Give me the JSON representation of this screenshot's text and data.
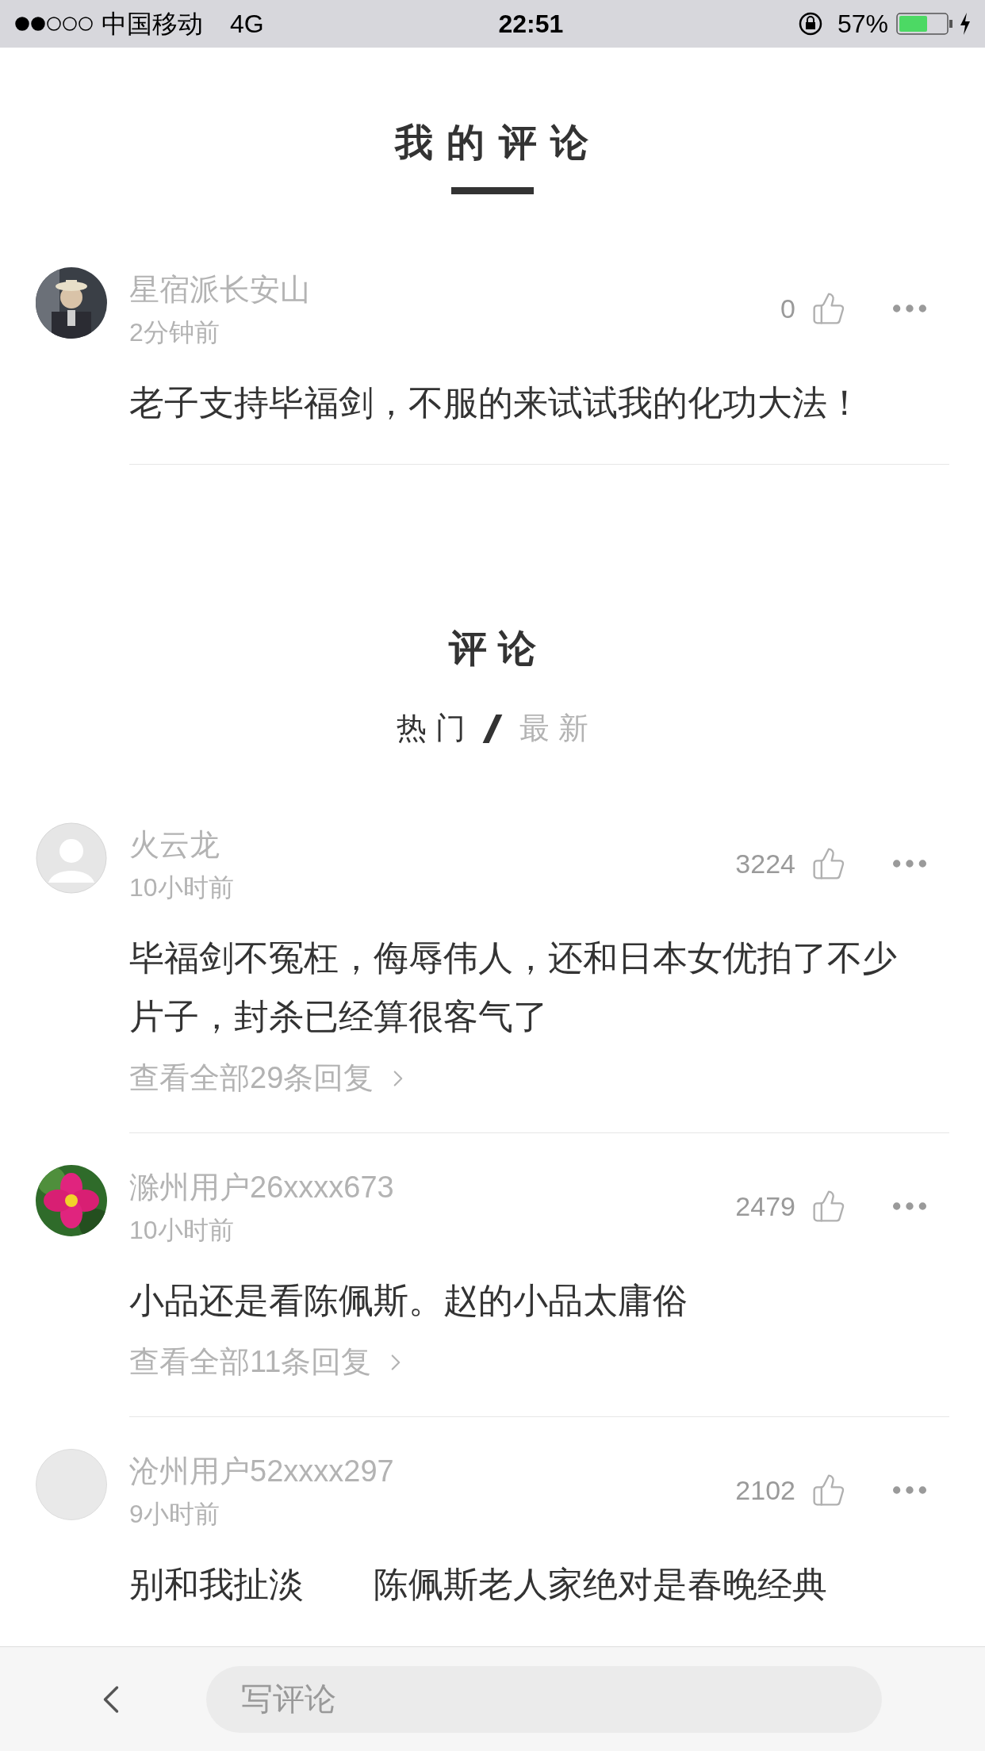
{
  "status_bar": {
    "carrier": "中国移动",
    "network": "4G",
    "time": "22:51",
    "battery": "57%"
  },
  "my_comments": {
    "title": "我 的 评 论",
    "items": [
      {
        "user": "星宿派长安山",
        "time": "2分钟前",
        "likes": "0",
        "text": "老子支持毕福剑，不服的来试试我的化功大法！"
      }
    ]
  },
  "comments": {
    "title": "评 论",
    "tabs": [
      {
        "label": "热 门",
        "selected": true
      },
      {
        "label": "最 新",
        "selected": false
      }
    ],
    "items": [
      {
        "user": "火云龙",
        "time": "10小时前",
        "likes": "3224",
        "text": "毕福剑不冤枉，侮辱伟人，还和日本女优拍了不少片子，封杀已经算很客气了",
        "replies": "查看全部29条回复",
        "avatar": {
          "kind": "default"
        }
      },
      {
        "user": "滁州用户26xxxx673",
        "time": "10小时前",
        "likes": "2479",
        "text": "小品还是看陈佩斯。赵的小品太庸俗",
        "replies": "查看全部11条回复"
      },
      {
        "user": "沧州用户52xxxx297",
        "time": "9小时前",
        "likes": "2102",
        "text": "别和我扯淡　　陈佩斯老人家绝对是春晚经典",
        "avatar": {
          "kind": "plain"
        }
      }
    ]
  },
  "bottom_bar": {
    "placeholder": "写评论"
  }
}
